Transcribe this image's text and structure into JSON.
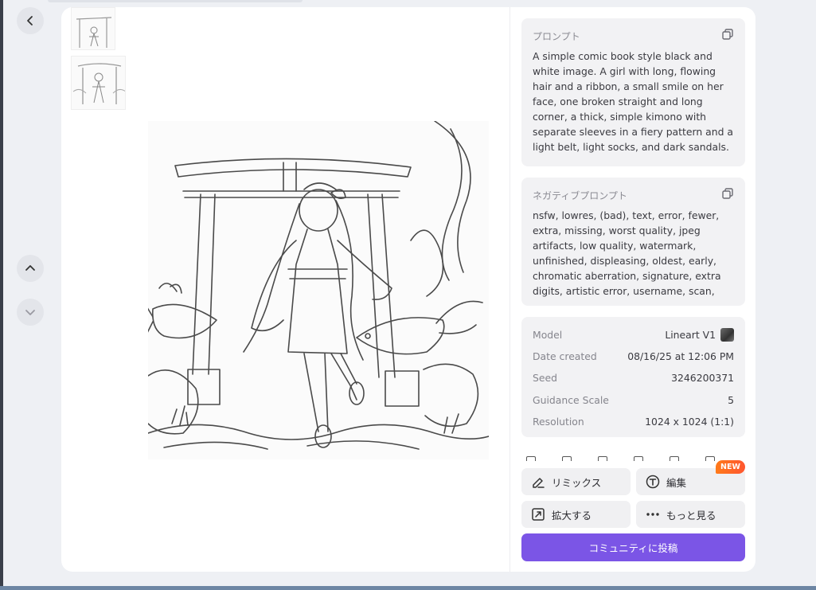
{
  "nav": {
    "back_icon": "chevron-left-icon",
    "up_icon": "chevron-up-icon",
    "down_icon": "chevron-down-icon"
  },
  "prompt": {
    "title": "プロンプト",
    "text": "A simple comic book style black and white image. A girl with long, flowing hair and a ribbon, a small smile on her face, one broken straight and long corner, a thick, simple kimono with separate sleeves in a fiery pattern and a light belt, light socks, and dark sandals. Koi fish with"
  },
  "negative_prompt": {
    "title": "ネガティブプロンプト",
    "text": "nsfw, lowres, (bad), text, error, fewer, extra, missing, worst quality, jpeg artifacts, low quality, watermark, unfinished, displeasing, oldest, early, chromatic aberration, signature, extra digits, artistic error, username, scan, [abstract]"
  },
  "meta": {
    "model_label": "Model",
    "model_value": "Lineart V1",
    "date_label": "Date created",
    "date_value": "08/16/25 at 12:06 PM",
    "seed_label": "Seed",
    "seed_value": "3246200371",
    "guidance_label": "Guidance Scale",
    "guidance_value": "5",
    "resolution_label": "Resolution",
    "resolution_value": "1024 x 1024 (1:1)"
  },
  "actions": {
    "remix": "リミックス",
    "edit": "編集",
    "new_badge": "NEW",
    "upscale": "拡大する",
    "more": "もっと見る",
    "post": "コミュニティに投稿"
  },
  "colors": {
    "accent": "#7b55e6",
    "badge": "#ff6a24",
    "panel": "#f2f2f4"
  }
}
